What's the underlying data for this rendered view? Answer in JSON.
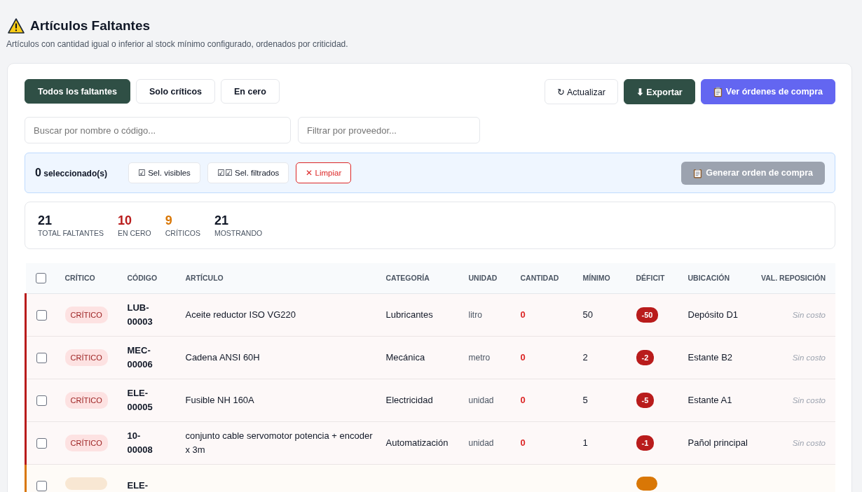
{
  "header": {
    "title": "Artículos Faltantes",
    "subtitle": "Artículos con cantidad igual o inferior al stock mínimo configurado, ordenados por criticidad."
  },
  "filter_tabs": [
    {
      "label": "Todos los faltantes",
      "selected": true
    },
    {
      "label": "Solo críticos",
      "selected": false
    },
    {
      "label": "En cero",
      "selected": false
    }
  ],
  "actions": [
    {
      "kind": "plain",
      "label": "↻ Actualizar"
    },
    {
      "kind": "dark",
      "label": "⬇ Exportar"
    },
    {
      "kind": "primary",
      "label": "Ver órdenes de compra"
    }
  ],
  "search": {
    "placeholder": "Buscar por nombre o código..."
  },
  "supplier_filter": {
    "placeholder": "Filtrar por proveedor..."
  },
  "selection_bar": {
    "count": "0",
    "count_label": "seleccionado(s)",
    "buttons": [
      {
        "kind": "plain",
        "label": "☑ Sel. visibles"
      },
      {
        "kind": "plain",
        "label": "☑☑ Sel. filtrados"
      },
      {
        "kind": "danger",
        "label": "✕ Limpiar"
      }
    ],
    "generate": {
      "label": "Generar orden de compra",
      "disabled": true
    }
  },
  "stats": [
    {
      "value": "21",
      "label": "TOTAL FALTANTES",
      "color": "#111827"
    },
    {
      "value": "10",
      "label": "EN CERO",
      "color": "#b91c1c"
    },
    {
      "value": "9",
      "label": "CRÍTICOS",
      "color": "#d97706"
    },
    {
      "value": "21",
      "label": "MOSTRANDO",
      "color": "#111827"
    }
  ],
  "table": {
    "columns": [
      "CRÍTICO",
      "CÓDIGO",
      "ARTÍCULO",
      "CATEGORÍA",
      "UNIDAD",
      "CANTIDAD",
      "MÍNIMO",
      "DÉFICIT",
      "UBICACIÓN",
      "VAL. REPOSICIÓN"
    ],
    "all_checked": false,
    "rows": [
      {
        "color": "#b91c1c",
        "checked": false,
        "badge": "CRÍTICO",
        "code": "LUB-\n00003",
        "article": "Aceite reductor ISO VG220",
        "category": "Lubricantes",
        "unit": "litro",
        "quantity": "0",
        "minimum": "50",
        "deficit": "-50",
        "location": "Depósito D1",
        "value": "Sin costo"
      },
      {
        "color": "#b91c1c",
        "checked": false,
        "badge": "CRÍTICO",
        "code": "MEC-\n00006",
        "article": "Cadena ANSI 60H",
        "category": "Mecánica",
        "unit": "metro",
        "quantity": "0",
        "minimum": "2",
        "deficit": "-2",
        "location": "Estante B2",
        "value": "Sin costo"
      },
      {
        "color": "#b91c1c",
        "checked": false,
        "badge": "CRÍTICO",
        "code": "ELE-\n00005",
        "article": "Fusible NH 160A",
        "category": "Electricidad",
        "unit": "unidad",
        "quantity": "0",
        "minimum": "5",
        "deficit": "-5",
        "location": "Estante A1",
        "value": "Sin costo"
      },
      {
        "color": "#b91c1c",
        "checked": false,
        "badge": "CRÍTICO",
        "code": "10-\n00008",
        "article": "conjunto cable servomotor potencia + encoder x 3m",
        "category": "Automatización",
        "unit": "unidad",
        "quantity": "0",
        "minimum": "1",
        "deficit": "-1",
        "location": "Pañol principal",
        "value": "Sin costo"
      },
      {
        "color": "#d97706",
        "checked": false,
        "code": "ELE-"
      }
    ]
  }
}
